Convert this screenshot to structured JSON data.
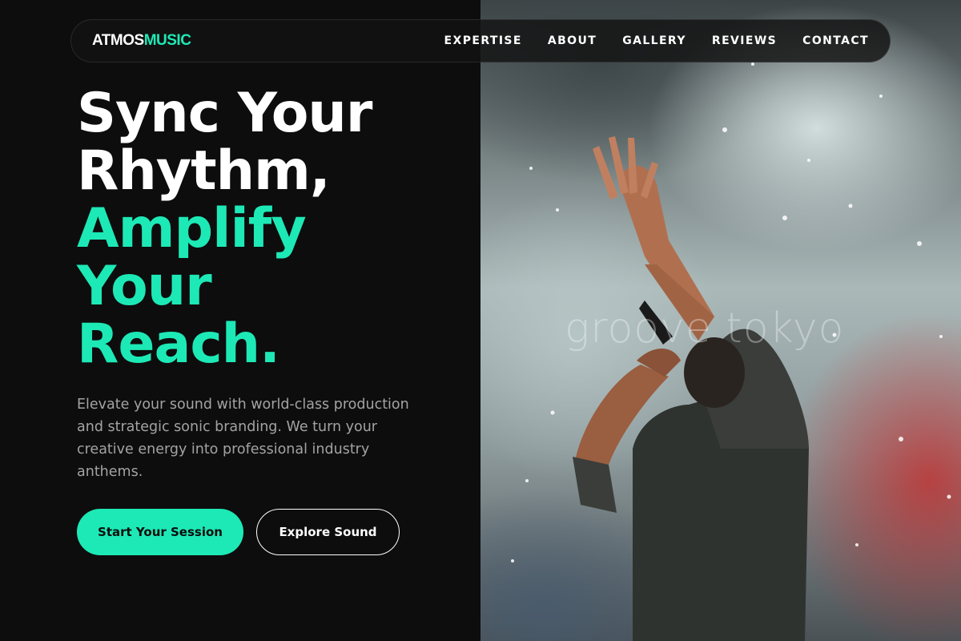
{
  "brand": {
    "logo_part1": "ATMOS",
    "logo_part2": "MUSIC",
    "accent_color": "#1de9b6",
    "background_color": "#0d0d0d"
  },
  "nav": {
    "items": [
      {
        "label": "EXPERTISE"
      },
      {
        "label": "ABOUT"
      },
      {
        "label": "GALLERY"
      },
      {
        "label": "REVIEWS"
      },
      {
        "label": "CONTACT"
      }
    ]
  },
  "hero": {
    "headline_lines": [
      {
        "text": "Sync Your",
        "color": "white"
      },
      {
        "text": "Rhythm,",
        "color": "white"
      },
      {
        "text": "Amplify",
        "color": "accent"
      },
      {
        "text": "Your",
        "color": "accent"
      },
      {
        "text": "Reach.",
        "color": "accent"
      }
    ],
    "description": "Elevate your sound with world-class production and strategic sonic branding. We turn your creative energy into professional industry anthems.",
    "primary_cta": "Start Your Session",
    "secondary_cta": "Explore Sound",
    "image_watermark": "groove tokyo"
  }
}
